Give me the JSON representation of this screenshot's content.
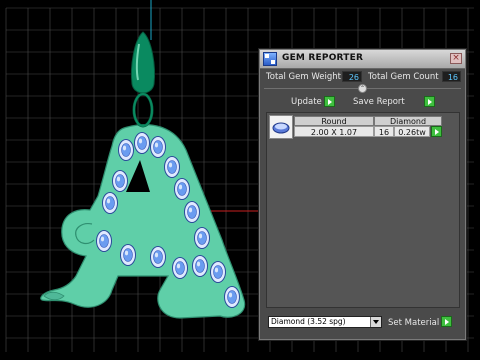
{
  "panel": {
    "title": "GEM REPORTER",
    "close_glyph": "×",
    "total_weight_label": "Total Gem Weight",
    "total_weight_value": "26",
    "total_count_label": "Total Gem Count",
    "total_count_value": "16",
    "collapse_glyph": "⌃",
    "update_label": "Update",
    "save_report_label": "Save Report",
    "table": {
      "headers": [
        "Round",
        "Diamond"
      ],
      "size": "2.00 X 1.07",
      "count": "16",
      "weight": "0.26tw"
    },
    "material_value": "Diamond   (3.52 spg)",
    "set_material_label": "Set Material"
  },
  "colors": {
    "pendant": "#5fcfa8",
    "bail": "#0a8a60",
    "gem": "#6a9cf0",
    "grid": "#4a4a4a",
    "accent_button": "#3fbf3f",
    "value_text": "#5ec8ff"
  },
  "icons": {
    "app": "gem-reporter-app-icon",
    "close": "close-icon",
    "collapse": "collapse-arrow-icon",
    "play": "play-icon",
    "gem_thumb": "round-gem-icon",
    "dropdown": "chevron-down-icon"
  }
}
